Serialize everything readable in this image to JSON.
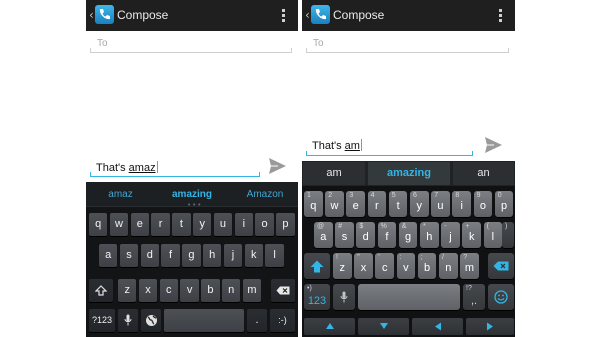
{
  "left": {
    "action_bar": {
      "up_glyph": "‹",
      "title": "Compose"
    },
    "to_placeholder": "To",
    "message": {
      "prefix": "That's ",
      "composing": "amaz"
    },
    "suggestions": {
      "left": "amaz",
      "center": "amazing",
      "right": "Amazon",
      "more_indicator": "•••"
    },
    "rows": [
      [
        "q",
        "w",
        "e",
        "r",
        "t",
        "y",
        "u",
        "i",
        "o",
        "p"
      ],
      [
        "a",
        "s",
        "d",
        "f",
        "g",
        "h",
        "j",
        "k",
        "l"
      ],
      [
        "z",
        "x",
        "c",
        "v",
        "b",
        "n",
        "m"
      ]
    ],
    "keys": {
      "symbols": "?123",
      "period": ".",
      "smiley": ":-)"
    }
  },
  "right": {
    "action_bar": {
      "up_glyph": "‹",
      "title": "Compose"
    },
    "to_placeholder": "To",
    "message": {
      "prefix": "That's ",
      "composing": "am"
    },
    "suggestions": {
      "left": "am",
      "center": "amazing",
      "right": "an"
    },
    "rows": [
      [
        {
          "k": "q",
          "h": "1"
        },
        {
          "k": "w",
          "h": "2"
        },
        {
          "k": "e",
          "h": "3"
        },
        {
          "k": "r",
          "h": "4"
        },
        {
          "k": "t",
          "h": "5"
        },
        {
          "k": "y",
          "h": "6"
        },
        {
          "k": "u",
          "h": "7"
        },
        {
          "k": "i",
          "h": "8"
        },
        {
          "k": "o",
          "h": "9"
        },
        {
          "k": "p",
          "h": "0"
        }
      ],
      [
        {
          "k": "a",
          "h": "@"
        },
        {
          "k": "s",
          "h": "#"
        },
        {
          "k": "d",
          "h": "$"
        },
        {
          "k": "f",
          "h": "%"
        },
        {
          "k": "g",
          "h": "&"
        },
        {
          "k": "h",
          "h": "*"
        },
        {
          "k": "j",
          "h": "-"
        },
        {
          "k": "k",
          "h": "+"
        },
        {
          "k": "l",
          "h": "("
        }
      ],
      [
        {
          "k": "z",
          "h": "!"
        },
        {
          "k": "x",
          "h": "\""
        },
        {
          "k": "c",
          "h": "'"
        },
        {
          "k": "v",
          "h": ":"
        },
        {
          "k": "b",
          "h": ";"
        },
        {
          "k": "n",
          "h": "/"
        },
        {
          "k": "m",
          "h": "?"
        }
      ]
    ],
    "extra_hints": {
      "row2_end": ")",
      "shift": "",
      "delete": ""
    },
    "keys": {
      "symbols": "123",
      "symbols_hint": "•)",
      "punct_hint": "!?",
      "punct_hint2": ",."
    }
  },
  "colors": {
    "accent": "#33b5e5",
    "action_bar": "#1f1f1f",
    "keyboard_bg": "#121416"
  }
}
